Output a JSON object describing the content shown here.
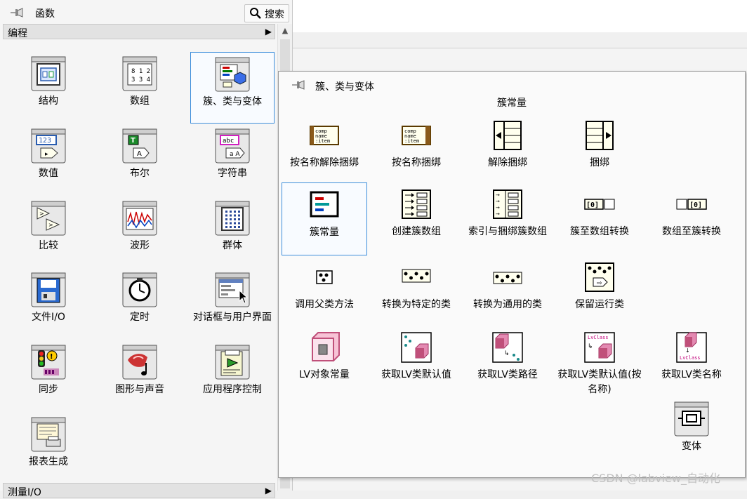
{
  "palette": {
    "title": "函数",
    "search_label": "搜索",
    "category": "编程",
    "next_category": "测量I/O",
    "items": [
      {
        "label": "结构",
        "icon": "structures-icon"
      },
      {
        "label": "数组",
        "icon": "array-icon"
      },
      {
        "label": "簇、类与变体",
        "icon": "cluster-class-variant-icon"
      },
      {
        "label": "数值",
        "icon": "numeric-icon"
      },
      {
        "label": "布尔",
        "icon": "boolean-icon"
      },
      {
        "label": "字符串",
        "icon": "string-icon"
      },
      {
        "label": "比较",
        "icon": "comparison-icon"
      },
      {
        "label": "波形",
        "icon": "waveform-icon"
      },
      {
        "label": "群体",
        "icon": "synchronization-group-icon"
      },
      {
        "label": "文件I/O",
        "icon": "file-io-icon"
      },
      {
        "label": "定时",
        "icon": "timing-icon"
      },
      {
        "label": "对话框与用户界面",
        "icon": "dialog-ui-icon"
      },
      {
        "label": "同步",
        "icon": "synchronization-icon"
      },
      {
        "label": "图形与声音",
        "icon": "graphics-sound-icon"
      },
      {
        "label": "应用程序控制",
        "icon": "application-control-icon"
      },
      {
        "label": "报表生成",
        "icon": "report-generation-icon"
      }
    ]
  },
  "subpalette": {
    "title": "簇、类与变体",
    "section": "簇常量",
    "items": [
      {
        "label": "按名称解除捆绑",
        "icon": "unbundle-by-name-icon"
      },
      {
        "label": "按名称捆绑",
        "icon": "bundle-by-name-icon"
      },
      {
        "label": "解除捆绑",
        "icon": "unbundle-icon"
      },
      {
        "label": "捆绑",
        "icon": "bundle-icon"
      },
      {
        "label": "簇常量",
        "icon": "cluster-constant-icon"
      },
      {
        "label": "创建簇数组",
        "icon": "build-cluster-array-icon"
      },
      {
        "label": "索引与捆绑簇数组",
        "icon": "index-bundle-cluster-array-icon"
      },
      {
        "label": "簇至数组转换",
        "icon": "cluster-to-array-icon"
      },
      {
        "label": "数组至簇转换",
        "icon": "array-to-cluster-icon"
      },
      {
        "label": "调用父类方法",
        "icon": "call-parent-method-icon"
      },
      {
        "label": "转换为特定的类",
        "icon": "to-more-specific-class-icon"
      },
      {
        "label": "转换为通用的类",
        "icon": "to-more-generic-class-icon"
      },
      {
        "label": "保留运行类",
        "icon": "preserve-run-time-class-icon"
      },
      {
        "label": "LV对象常量",
        "icon": "lv-object-constant-icon"
      },
      {
        "label": "获取LV类默认值",
        "icon": "get-lv-class-default-value-icon"
      },
      {
        "label": "获取LV类路径",
        "icon": "get-lv-class-path-icon"
      },
      {
        "label": "获取LV类默认值(按名称)",
        "icon": "get-lv-class-default-value-by-name-icon"
      },
      {
        "label": "获取LV类名称",
        "icon": "get-lv-class-name-icon"
      },
      {
        "label": "变体",
        "icon": "variant-icon"
      }
    ]
  },
  "watermark": "CSDN @labview_自动化",
  "colors": {
    "selection_border": "#3c8ddb",
    "lvclass_pink": "#c0507a"
  }
}
